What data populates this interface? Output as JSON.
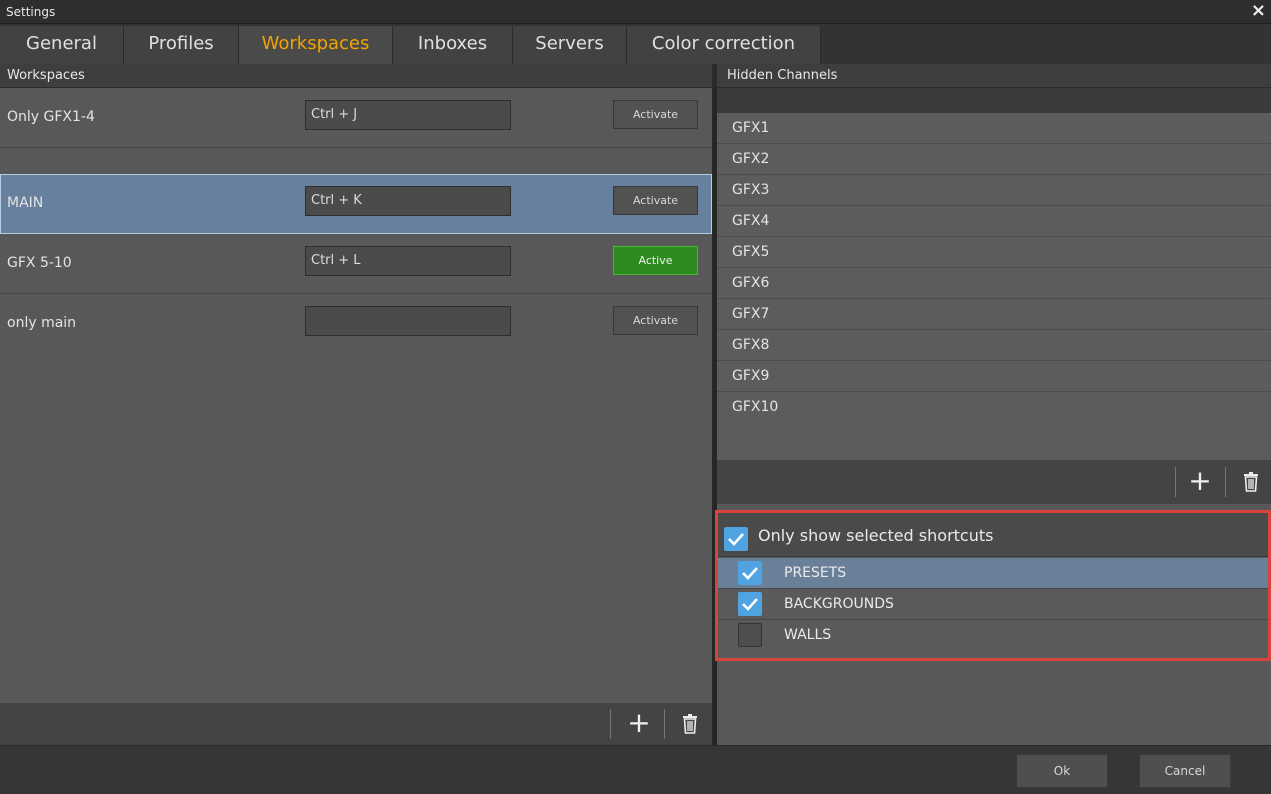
{
  "window": {
    "title": "Settings",
    "close_label": "×"
  },
  "tabs": [
    {
      "label": "General"
    },
    {
      "label": "Profiles"
    },
    {
      "label": "Workspaces",
      "active": true
    },
    {
      "label": "Inboxes"
    },
    {
      "label": "Servers"
    },
    {
      "label": "Color correction"
    }
  ],
  "workspaces": {
    "header": "Workspaces",
    "rows": [
      {
        "name": "Only GFX1-4",
        "shortcut": "Ctrl + J",
        "button": "Activate",
        "selected": false,
        "active": false
      },
      {
        "name": "MAIN",
        "shortcut": "Ctrl + K",
        "button": "Activate",
        "selected": true,
        "active": false
      },
      {
        "name": "GFX 5-10",
        "shortcut": "Ctrl + L",
        "button": "Active",
        "selected": false,
        "active": true
      },
      {
        "name": "only main",
        "shortcut": "",
        "button": "Activate",
        "selected": false,
        "active": false
      }
    ],
    "add_label": "+",
    "add_icon": "plus-icon",
    "delete_icon": "trash-icon"
  },
  "hidden_channels": {
    "header": "Hidden Channels",
    "items": [
      "GFX1",
      "GFX2",
      "GFX3",
      "GFX4",
      "GFX5",
      "GFX6",
      "GFX7",
      "GFX8",
      "GFX9",
      "GFX10"
    ],
    "add_label": "+",
    "add_icon": "plus-icon",
    "delete_icon": "trash-icon"
  },
  "shortcuts": {
    "only_show_label": "Only show selected shortcuts",
    "only_show_checked": true,
    "items": [
      {
        "label": "PRESETS",
        "checked": true,
        "selected": true
      },
      {
        "label": "BACKGROUNDS",
        "checked": true,
        "selected": false
      },
      {
        "label": "WALLS",
        "checked": false,
        "selected": false
      }
    ]
  },
  "dialog": {
    "ok_label": "Ok",
    "cancel_label": "Cancel"
  },
  "colors": {
    "accent": "#f3a300",
    "active_green": "#2d8c1f",
    "selection": "#66809e",
    "checkbox": "#4fa3e0",
    "highlight_border": "#d8433d"
  }
}
